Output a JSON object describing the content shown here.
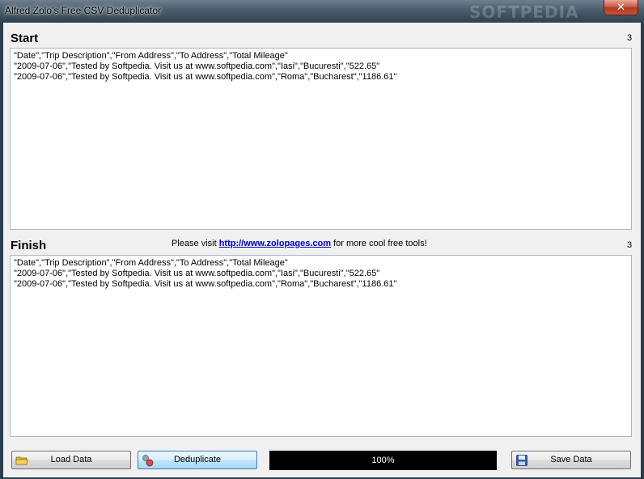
{
  "window": {
    "title": "Alfred Zolo's Free CSV Deduplicator",
    "close_symbol": "✕",
    "watermark": "SOFTPEDIA"
  },
  "start": {
    "title": "Start",
    "count": "3",
    "lines": [
      "\"Date\",\"Trip Description\",\"From Address\",\"To Address\",\"Total Mileage\"",
      "\"2009-07-06\",\"Tested by Softpedia. Visit us at www.softpedia.com\",\"Iasi\",\"Bucuresti\",\"522.65\"",
      "\"2009-07-06\",\"Tested by Softpedia. Visit us at www.softpedia.com\",\"Roma\",\"Bucharest\",\"1186.61\""
    ]
  },
  "finish": {
    "title": "Finish",
    "count": "3",
    "lines": [
      "\"Date\",\"Trip Description\",\"From Address\",\"To Address\",\"Total Mileage\"",
      "\"2009-07-06\",\"Tested by Softpedia. Visit us at www.softpedia.com\",\"Iasi\",\"Bucuresti\",\"522.65\"",
      "\"2009-07-06\",\"Tested by Softpedia. Visit us at www.softpedia.com\",\"Roma\",\"Bucharest\",\"1186.61\""
    ]
  },
  "visit": {
    "prefix": "Please visit ",
    "link": "http://www.zolopages.com",
    "suffix": " for more cool free tools!"
  },
  "buttons": {
    "load": "Load Data",
    "dedup": "Deduplicate",
    "save": "Save Data"
  },
  "progress": {
    "value": 100,
    "label": "100%"
  },
  "icons": {
    "load": "folder-icon",
    "dedup": "dedup-icon",
    "save": "floppy-disk-icon"
  }
}
